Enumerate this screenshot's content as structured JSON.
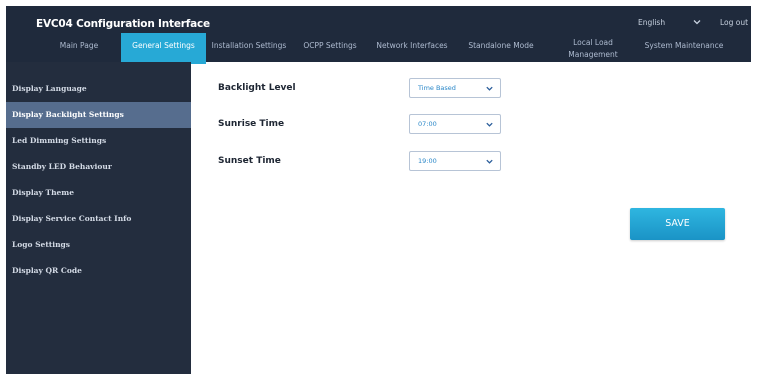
{
  "header": {
    "title": "EVC04 Configuration Interface",
    "language": "English",
    "logout_label": "Log out"
  },
  "nav": {
    "tabs": [
      {
        "label": "Main Page"
      },
      {
        "label": "General Settings"
      },
      {
        "label": "Installation Settings"
      },
      {
        "label": "OCPP Settings"
      },
      {
        "label": "Network Interfaces"
      },
      {
        "label": "Standalone Mode"
      },
      {
        "label": "Local Load Management"
      },
      {
        "label": "System Maintenance"
      }
    ],
    "active_tab": "General Settings"
  },
  "sidebar": {
    "items": [
      {
        "label": "Display Language"
      },
      {
        "label": "Display Backlight Settings"
      },
      {
        "label": "Led Dimming Settings"
      },
      {
        "label": "Standby LED Behaviour"
      },
      {
        "label": "Display Theme"
      },
      {
        "label": "Display Service Contact Info"
      },
      {
        "label": "Logo Settings"
      },
      {
        "label": "Display QR Code"
      }
    ],
    "active_item": "Display Backlight Settings"
  },
  "form": {
    "backlight_level": {
      "label": "Backlight Level",
      "value": "Time Based"
    },
    "sunrise_time": {
      "label": "Sunrise Time",
      "value": "07:00"
    },
    "sunset_time": {
      "label": "Sunset Time",
      "value": "19:00"
    },
    "save_label": "SAVE"
  },
  "colors": {
    "header_bg": "#1f2a3c",
    "sidebar_bg": "#232d3e",
    "sidebar_active": "#566d8e",
    "accent": "#27a9d6",
    "select_value": "#2a87c8"
  },
  "icons": {
    "select_caret": "chevron-down-icon",
    "language_caret": "chevron-down-icon"
  }
}
